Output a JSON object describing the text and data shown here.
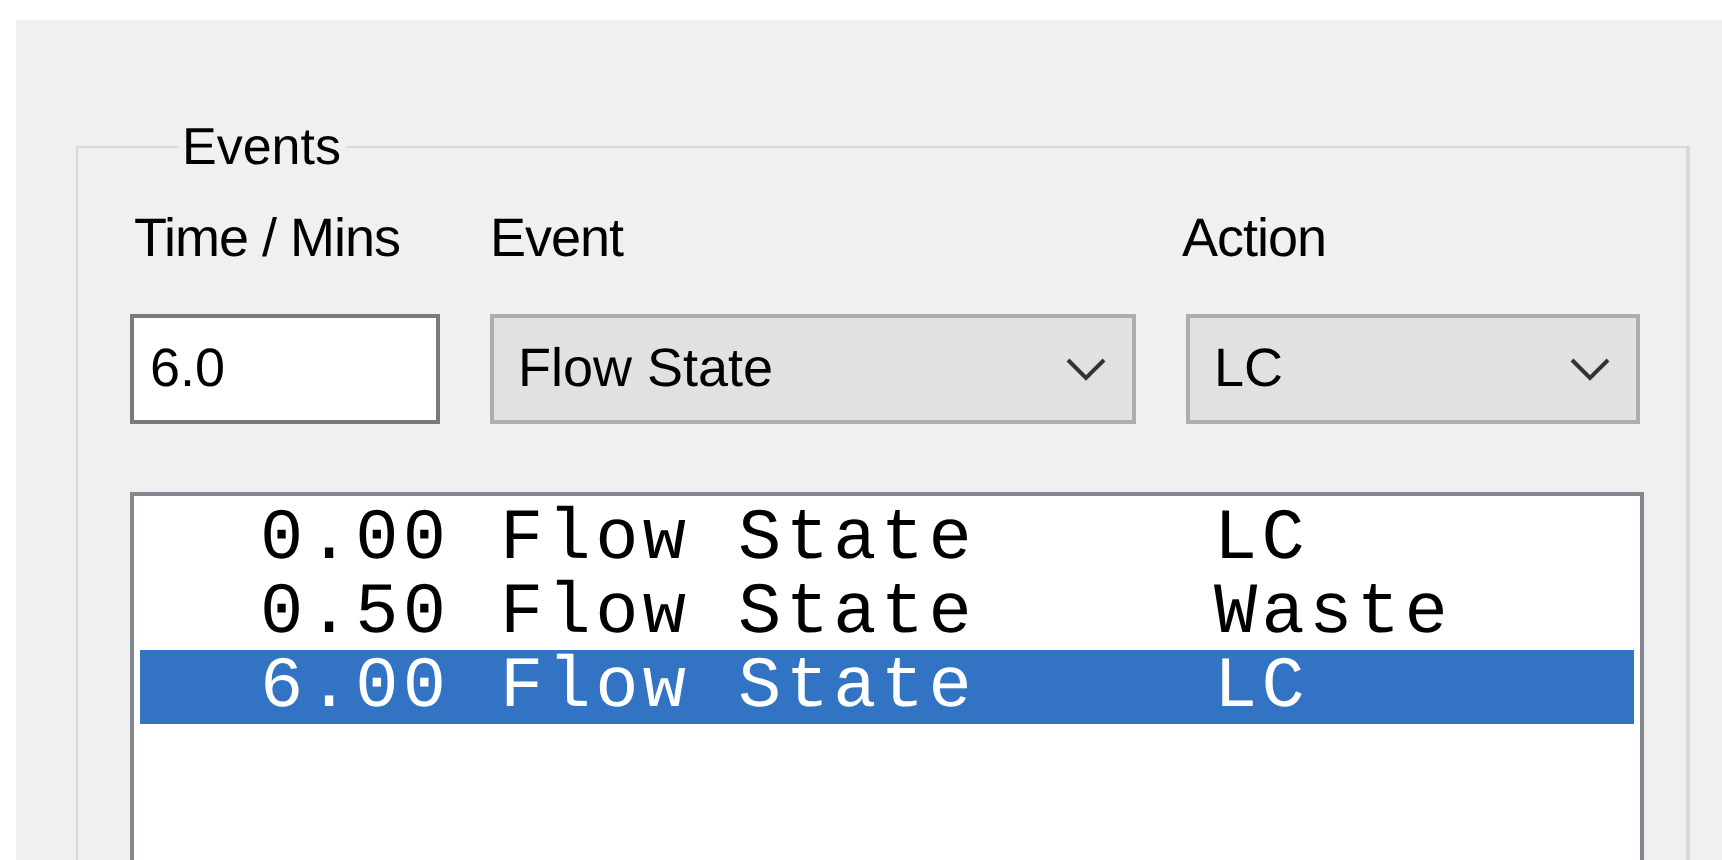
{
  "group": {
    "title": "Events"
  },
  "labels": {
    "time": "Time / Mins",
    "event": "Event",
    "action": "Action"
  },
  "time_field": {
    "value": "6.0"
  },
  "event_dropdown": {
    "value": "Flow State"
  },
  "action_dropdown": {
    "value": "LC"
  },
  "events_list": [
    {
      "time": "0.00",
      "event": "Flow State",
      "action": "LC",
      "selected": false
    },
    {
      "time": "0.50",
      "event": "Flow State",
      "action": "Waste",
      "selected": false
    },
    {
      "time": "6.00",
      "event": "Flow State",
      "action": "LC",
      "selected": true
    }
  ]
}
